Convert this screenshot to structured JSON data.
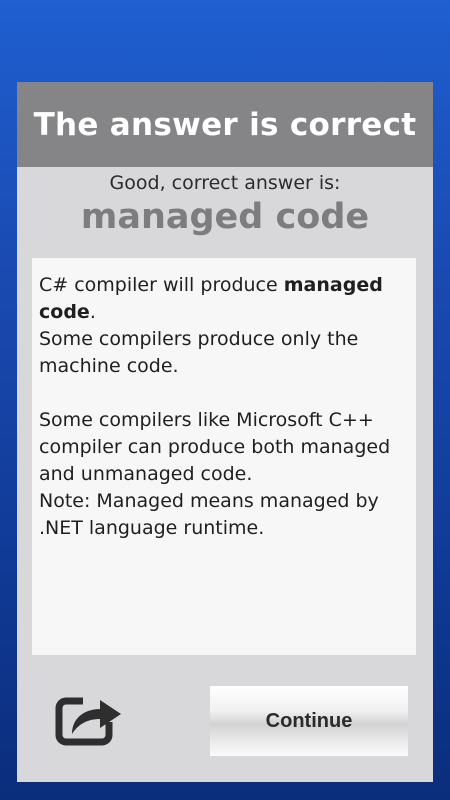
{
  "dialog": {
    "title": "The answer is correct",
    "good_text": "Good, correct answer is:",
    "answer": "managed code",
    "explanation": {
      "line1_prefix": "C# compiler will produce ",
      "line1_bold": "managed code",
      "line1_suffix": ".",
      "line2": "Some compilers produce only the machine code.",
      "line3": "Some compilers like Microsoft C++ compiler can produce both managed and unmanaged code.",
      "line4": "Note: Managed means managed by .NET language runtime."
    },
    "continue_label": "Continue",
    "share_icon": "share-icon"
  },
  "colors": {
    "header_bg": "#858587",
    "dialog_bg": "#d8d7da",
    "answer_color": "#7d7d7f",
    "background_blue": "#1a49b0"
  }
}
